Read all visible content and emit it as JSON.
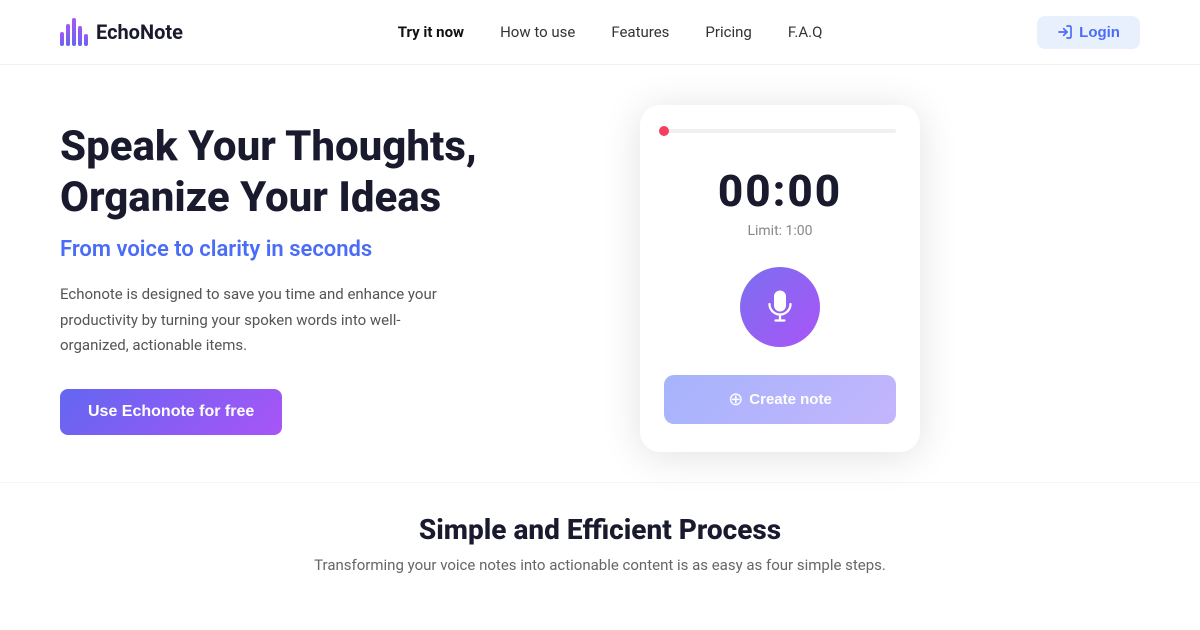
{
  "navbar": {
    "logo_text": "EchoNote",
    "links": [
      {
        "label": "Try it now",
        "active": true
      },
      {
        "label": "How to use",
        "active": false
      },
      {
        "label": "Features",
        "active": false
      },
      {
        "label": "Pricing",
        "active": false
      },
      {
        "label": "F.A.Q",
        "active": false
      }
    ],
    "login_label": "Login"
  },
  "hero": {
    "title": "Speak Your Thoughts, Organize Your Ideas",
    "subtitle": "From voice to clarity in seconds",
    "description": "Echonote is designed to save you time and enhance your productivity by turning your spoken words into well-organized, actionable items.",
    "cta_label": "Use Echonote for free"
  },
  "recorder": {
    "timer": "00:00",
    "limit_label": "Limit: 1:00",
    "create_note_label": "Create note"
  },
  "bottom": {
    "title": "Simple and Efficient Process",
    "description": "Transforming your voice notes into actionable content is as easy as four simple steps."
  }
}
